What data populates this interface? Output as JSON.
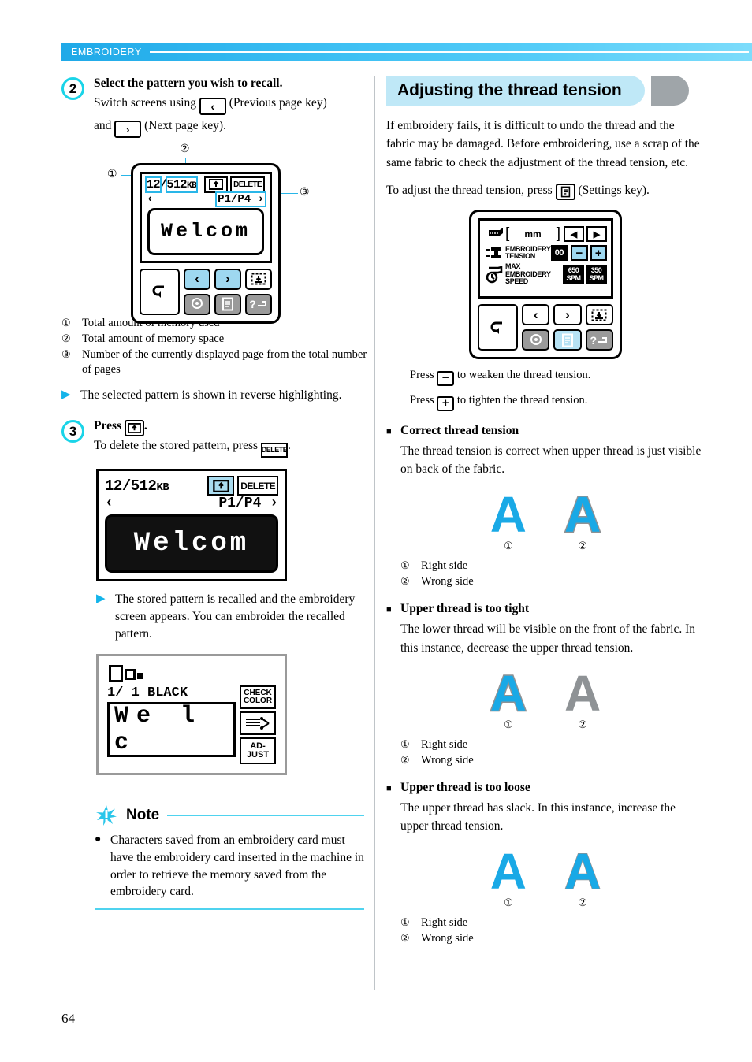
{
  "header": {
    "section_label": "EMBROIDERY",
    "accent_color": "#29b6e8"
  },
  "page_number": "64",
  "left_column": {
    "step2": {
      "number": "2",
      "title": "Select the pattern you wish to recall.",
      "line1_before": "Switch screens using",
      "prev_key_glyph": "‹",
      "line1_after": "(Previous page key)",
      "line2_before": "and",
      "next_key_glyph": "›",
      "line2_after": "(Next page key)."
    },
    "screen1": {
      "callout_1": "1",
      "callout_2": "2",
      "callout_3": "3",
      "memory_used": "12",
      "memory_sep": "/",
      "memory_total": "512",
      "memory_unit": "KB",
      "delete_label": "DELETE",
      "page_indicator": "P1/P4",
      "prev_arrow": "‹",
      "next_arrow": "›",
      "pattern_text": "Welcom",
      "keys": {
        "back": "↶",
        "prev": "‹",
        "next": "›",
        "memory": "memory-key",
        "stitch": "stitch-key",
        "settings": "settings-key",
        "help": "?"
      }
    },
    "legend1": [
      {
        "num": "①",
        "text": "Total amount of memory used"
      },
      {
        "num": "②",
        "text": "Total amount of memory space"
      },
      {
        "num": "③",
        "text": "Number of the currently displayed page from the total number of pages"
      }
    ],
    "result1": "The selected pattern is shown in reverse highlighting.",
    "step3": {
      "number": "3",
      "title_before": "Press",
      "title_after": ".",
      "line2_before": "To delete the stored pattern, press",
      "delete_label": "DELETE",
      "line2_after": "."
    },
    "screen2": {
      "memory_used": "12",
      "memory_sep": "/",
      "memory_total": "512",
      "memory_unit": "KB",
      "delete_label": "DELETE",
      "page_indicator": "P1/P4",
      "prev_arrow": "‹",
      "next_arrow": "›",
      "pattern_text": "Welcom"
    },
    "result2": "The stored pattern is recalled and the embroidery screen appears. You can embroider the recalled pattern.",
    "screen3": {
      "color_line": "1/ 1 BLACK",
      "pattern_text": "We l c",
      "btn_check_color_l1": "CHECK",
      "btn_check_color_l2": "COLOR",
      "btn_thread": "thread-cut-key",
      "btn_adjust_l1": "AD-",
      "btn_adjust_l2": "JUST"
    },
    "note": {
      "title": "Note",
      "bullet": "●",
      "text": "Characters saved from an embroidery card must have the embroidery card inserted in the machine in order to retrieve the memory saved from the embroidery card."
    }
  },
  "right_column": {
    "heading": "Adjusting the thread tension",
    "intro_p1": "If embroidery fails, it is difficult to undo the thread and the fabric may be damaged. Before embroidering, use a scrap of the same fabric to check the adjustment of the thread tension, etc.",
    "intro_p2_before": "To adjust the thread tension, press",
    "intro_p2_after": "(Settings key).",
    "settings_screen": {
      "row1_unit": "mm",
      "row1_left_arrow": "◀",
      "row1_right_arrow": "▶",
      "row2_label_l1": "EMBROIDERY",
      "row2_label_l2": "TENSION",
      "row2_value": "00",
      "row2_minus": "−",
      "row2_plus": "+",
      "row3_label_l1": "MAX EMBROIDERY",
      "row3_label_l2": "SPEED",
      "row3_value1_l1": "650",
      "row3_value1_l2": "SPM",
      "row3_value2_l1": "350",
      "row3_value2_l2": "SPM",
      "keys": {
        "back": "↶",
        "prev": "‹",
        "next": "›",
        "memory": "memory-key",
        "stitch": "stitch-key",
        "settings": "settings-key",
        "help": "?"
      }
    },
    "press_minus_before": "Press",
    "press_minus_glyph": "−",
    "press_minus_after": "to weaken the thread tension.",
    "press_plus_before": "Press",
    "press_plus_glyph": "+",
    "press_plus_after": "to tighten the thread tension.",
    "sections": [
      {
        "bullet": "■",
        "heading": "Correct thread tension",
        "body": "The thread tension is correct when upper thread is just visible on back of the fabric.",
        "samples": [
          {
            "letter": "A",
            "num": "①",
            "style": "a-cyan"
          },
          {
            "letter": "A",
            "num": "②",
            "style": "a-cyan-grayedge"
          }
        ],
        "legend": [
          {
            "num": "①",
            "text": "Right side"
          },
          {
            "num": "②",
            "text": "Wrong side"
          }
        ]
      },
      {
        "bullet": "■",
        "heading": "Upper thread is too tight",
        "body": "The lower thread will be visible on the front of the fabric. In this instance, decrease the upper thread tension.",
        "samples": [
          {
            "letter": "A",
            "num": "①",
            "style": "a-cyan-grayedge"
          },
          {
            "letter": "A",
            "num": "②",
            "style": "a-gray"
          }
        ],
        "legend": [
          {
            "num": "①",
            "text": "Right side"
          },
          {
            "num": "②",
            "text": "Wrong side"
          }
        ]
      },
      {
        "bullet": "■",
        "heading": "Upper thread is too loose",
        "body": "The upper thread has slack. In this instance, increase the upper thread tension.",
        "samples": [
          {
            "letter": "A",
            "num": "①",
            "style": "a-cyan"
          },
          {
            "letter": "A",
            "num": "②",
            "style": "a-cyan-grayline"
          }
        ],
        "legend": [
          {
            "num": "①",
            "text": "Right side"
          },
          {
            "num": "②",
            "text": "Wrong side"
          }
        ]
      }
    ]
  }
}
